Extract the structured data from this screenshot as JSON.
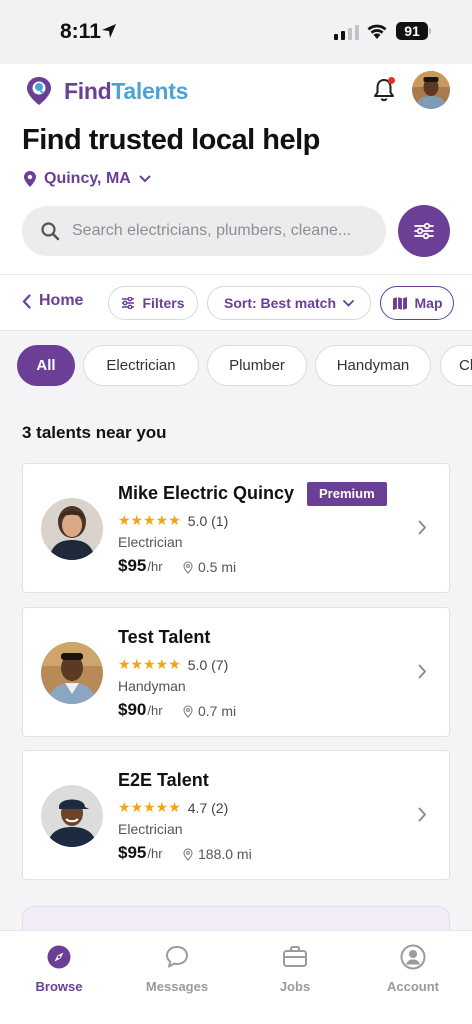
{
  "status_bar": {
    "time": "8:11",
    "battery": "91"
  },
  "brand": {
    "part1": "Find",
    "part2": "Talents"
  },
  "colors": {
    "accent": "#6a3f95",
    "brand_blue": "#4ba3d6",
    "star": "#f2a516",
    "notification_dot": "#e0332e"
  },
  "page": {
    "title": "Find trusted local help",
    "location": "Quincy, MA"
  },
  "search": {
    "placeholder": "Search electricians, plumbers, cleane..."
  },
  "toolbar": {
    "back_label": "Home",
    "filters_label": "Filters",
    "sort_label": "Sort: Best match",
    "map_label": "Map"
  },
  "categories": [
    {
      "label": "All",
      "active": true
    },
    {
      "label": "Electrician",
      "active": false
    },
    {
      "label": "Plumber",
      "active": false
    },
    {
      "label": "Handyman",
      "active": false
    },
    {
      "label": "Cl",
      "active": false
    }
  ],
  "results": {
    "count_text": "3 talents near you",
    "items": [
      {
        "name": "Mike Electric Quincy",
        "badge": "Premium",
        "stars": "★★★★★",
        "rating": "5.0 (1)",
        "category": "Electrician",
        "price": "$95",
        "unit": "/hr",
        "distance": "0.5 mi"
      },
      {
        "name": "Test Talent",
        "badge": "",
        "stars": "★★★★★",
        "rating": "5.0 (7)",
        "category": "Handyman",
        "price": "$90",
        "unit": "/hr",
        "distance": "0.7 mi"
      },
      {
        "name": "E2E Talent",
        "badge": "",
        "stars": "★★★★★",
        "rating": "4.7 (2)",
        "category": "Electrician",
        "price": "$95",
        "unit": "/hr",
        "distance": "188.0 mi"
      }
    ]
  },
  "nav": {
    "tabs": [
      {
        "label": "Browse",
        "icon": "compass-icon",
        "active": true
      },
      {
        "label": "Messages",
        "icon": "chat-icon",
        "active": false
      },
      {
        "label": "Jobs",
        "icon": "briefcase-icon",
        "active": false
      },
      {
        "label": "Account",
        "icon": "user-icon",
        "active": false
      }
    ]
  }
}
